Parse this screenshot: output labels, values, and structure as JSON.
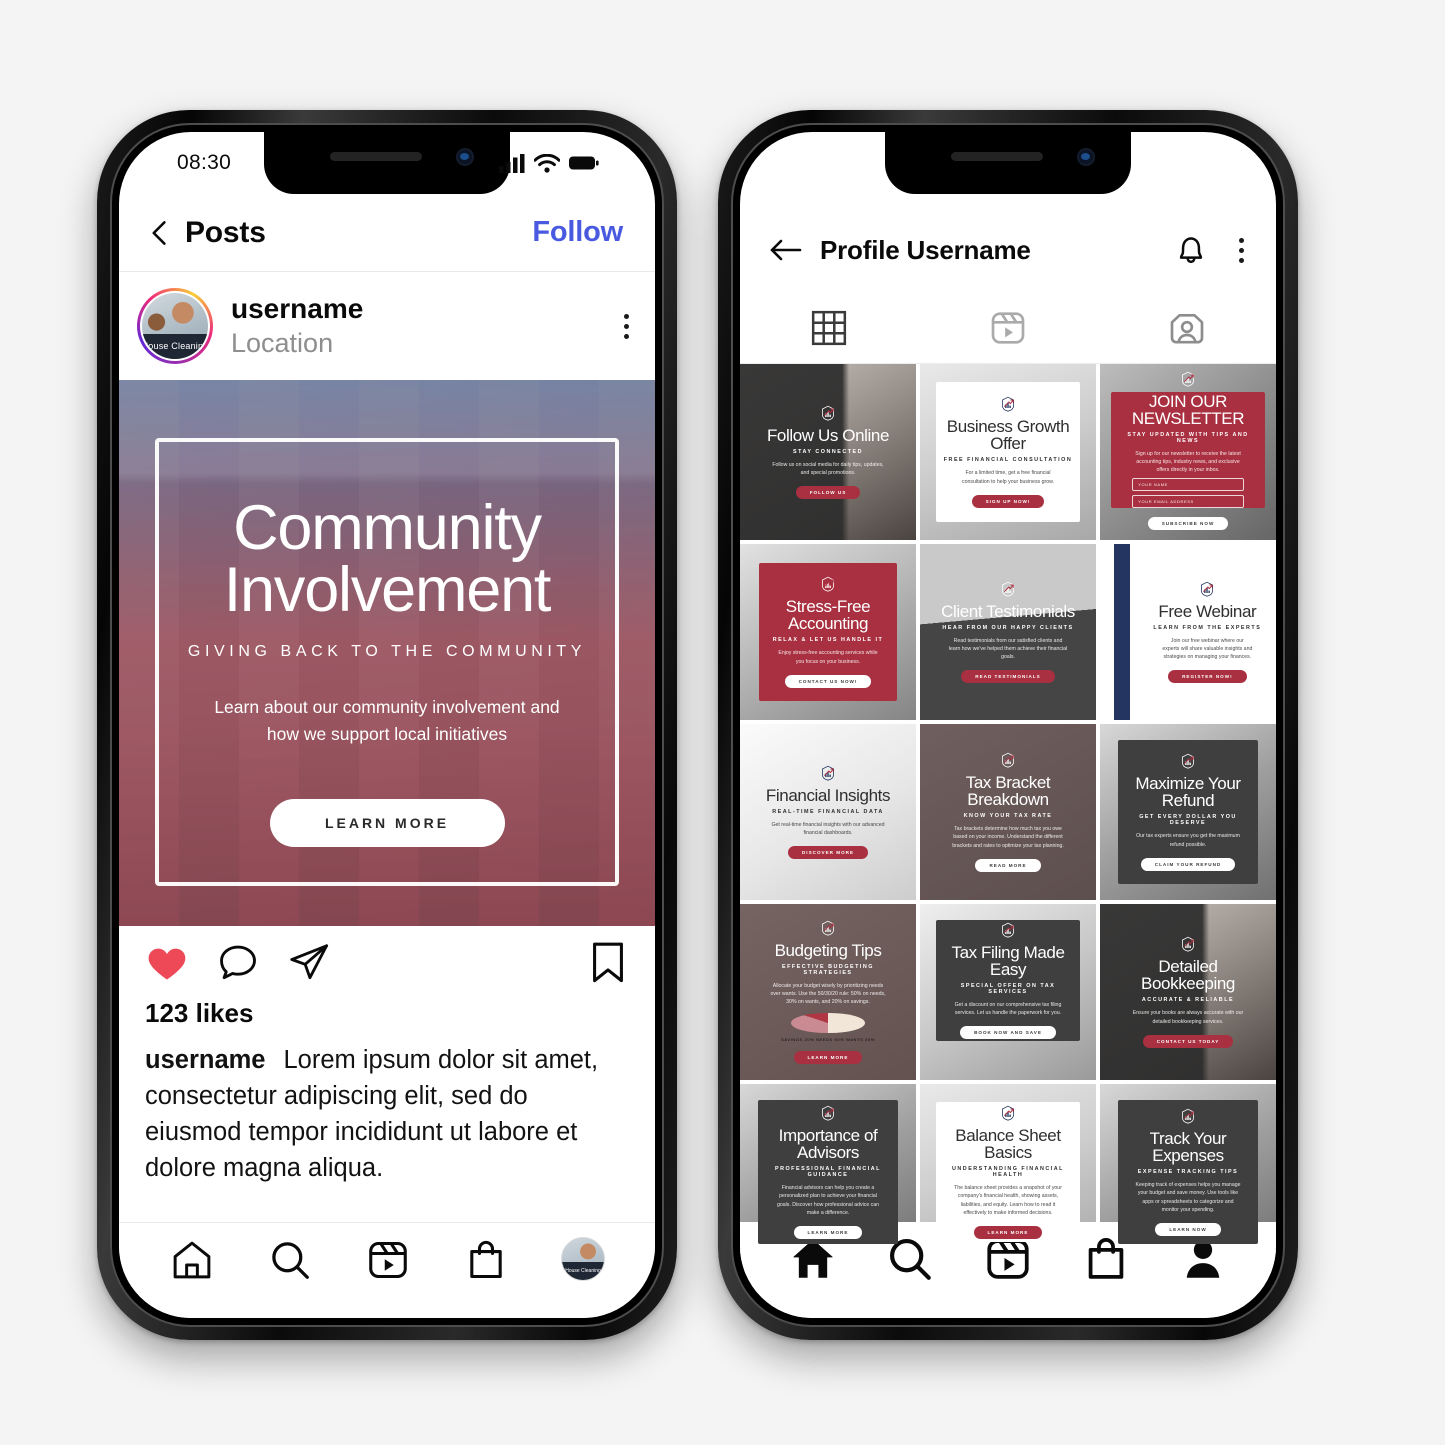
{
  "phone_one": {
    "status_bar": {
      "time": "08:30",
      "icons": [
        "signal-icon",
        "wifi-icon",
        "battery-icon"
      ]
    },
    "top_bar": {
      "back_icon": "chevron-left-icon",
      "title": "Posts",
      "follow_label": "Follow"
    },
    "post_header": {
      "avatar_caption": "House Cleaning",
      "username": "username",
      "location": "Location",
      "menu_icon": "kebab-menu-icon"
    },
    "post": {
      "title_line_1": "Community",
      "title_line_2": "Involvement",
      "subtitle": "GIVING BACK TO THE COMMUNITY",
      "description": "Learn about our community involvement and how we support local initiatives",
      "cta_label": "LEARN MORE",
      "gradient_top": "#23386c",
      "gradient_bottom": "#a8303f"
    },
    "actions": {
      "like_icon": "heart-icon-filled",
      "like_color": "#ed4956",
      "comment_icon": "comment-icon",
      "share_icon": "paper-plane-icon",
      "save_icon": "bookmark-icon"
    },
    "likes_text": "123 likes",
    "caption": {
      "username": "username",
      "text": "Lorem ipsum dolor sit amet, consectetur adipiscing elit, sed do eiusmod tempor incididunt ut labore et dolore magna aliqua."
    },
    "bottom_nav": [
      {
        "name": "home",
        "icon": "home-icon"
      },
      {
        "name": "search",
        "icon": "search-icon"
      },
      {
        "name": "reels",
        "icon": "reels-icon"
      },
      {
        "name": "shop",
        "icon": "shopping-bag-icon"
      },
      {
        "name": "profile",
        "icon": "avatar-icon",
        "avatar_caption": "House Cleaning"
      }
    ]
  },
  "phone_two": {
    "top_bar": {
      "back_icon": "arrow-left-icon",
      "title": "Profile Username",
      "bell_icon": "bell-icon",
      "menu_icon": "kebab-menu-icon"
    },
    "tabs": [
      {
        "id": "grid",
        "icon": "grid-icon",
        "active": true
      },
      {
        "id": "reels",
        "icon": "reels-icon",
        "active": false
      },
      {
        "id": "tagged",
        "icon": "tagged-person-icon",
        "active": false
      }
    ],
    "grid": [
      {
        "title": "Follow Us Online",
        "subtitle": "STAY CONNECTED",
        "body": "Follow us on social media for daily tips, updates, and special promotions.",
        "button": "FOLLOW US",
        "theme": "dark-photo-right"
      },
      {
        "title": "Business Growth Offer",
        "subtitle": "FREE FINANCIAL CONSULTATION",
        "body": "For a limited time, get a free financial consultation to help your business grow.",
        "button": "SIGN UP NOW!",
        "theme": "white-card"
      },
      {
        "title": "JOIN OUR NEWSLETTER",
        "subtitle": "STAY UPDATED WITH TIPS AND NEWS",
        "body": "Sign up for our newsletter to receive the latest accounting tips, industry news, and exclusive offers directly in your inbox.",
        "button": "SUBSCRIBE NOW",
        "fields": [
          "YOUR NAME",
          "YOUR EMAIL ADDRESS"
        ],
        "theme": "red-card"
      },
      {
        "title": "Stress-Free Accounting",
        "subtitle": "RELAX & LET US HANDLE IT",
        "body": "Enjoy stress-free accounting services while you focus on your business.",
        "button": "CONTACT US NOW!",
        "theme": "red-card-photo"
      },
      {
        "title": "Client Testimonials",
        "subtitle": "HEAR FROM OUR HAPPY CLIENTS",
        "body": "Read testimonials from our satisfied clients and learn how we've helped them achieve their financial goals.",
        "button": "READ TESTIMONIALS",
        "theme": "gray-photo"
      },
      {
        "title": "Free Webinar",
        "subtitle": "LEARN FROM THE EXPERTS",
        "body": "Join our free webinar where our experts will share valuable insights and strategies on managing your finances.",
        "button": "REGISTER NOW!",
        "theme": "white-split"
      },
      {
        "title": "Financial Insights",
        "subtitle": "REAL-TIME FINANCIAL DATA",
        "body": "Get real-time financial insights with our advanced financial dashboards.",
        "button": "DISCOVER MORE",
        "theme": "light-photo"
      },
      {
        "title": "Tax Bracket Breakdown",
        "subtitle": "KNOW YOUR TAX RATE",
        "body": "Tax brackets determine how much tax you owe based on your income. Understand the different brackets and rates to optimize your tax planning.",
        "button": "READ MORE",
        "theme": "mauve"
      },
      {
        "title": "Maximize Your Refund",
        "subtitle": "GET EVERY DOLLAR YOU DESERVE",
        "body": "Our tax experts ensure you get the maximum refund possible.",
        "button": "CLAIM YOUR REFUND",
        "theme": "charcoal-card"
      },
      {
        "title": "Budgeting Tips",
        "subtitle": "EFFECTIVE BUDGETING STRATEGIES",
        "body": "Allocate your budget wisely by prioritizing needs over wants. Use the 50/30/20 rule: 50% on needs, 30% on wants, and 20% on savings.",
        "button": "LEARN MORE",
        "theme": "mauve-pie",
        "pie_labels": [
          "SAVINGS 20%",
          "NEEDS 50%",
          "WANTS 30%"
        ]
      },
      {
        "title": "Tax Filing Made Easy",
        "subtitle": "SPECIAL OFFER ON TAX SERVICES",
        "body": "Get a discount on our comprehensive tax filing services. Let us handle the paperwork for you.",
        "button": "BOOK NOW AND SAVE",
        "theme": "charcoal-photo"
      },
      {
        "title": "Detailed Bookkeeping",
        "subtitle": "ACCURATE & RELIABLE",
        "body": "Ensure your books are always accurate with our detailed bookkeeping services.",
        "button": "CONTACT US TODAY",
        "theme": "dark-photo-right"
      },
      {
        "title": "Importance of Advisors",
        "subtitle": "PROFESSIONAL FINANCIAL GUIDANCE",
        "body": "Financial advisors can help you create a personalized plan to achieve your financial goals. Discover how professional advice can make a difference.",
        "button": "LEARN MORE",
        "theme": "charcoal-card"
      },
      {
        "title": "Balance Sheet Basics",
        "subtitle": "UNDERSTANDING FINANCIAL HEALTH",
        "body": "The balance sheet provides a snapshot of your company's financial health, showing assets, liabilities, and equity. Learn how to read it effectively to make informed decisions.",
        "button": "LEARN MORE",
        "theme": "white-card"
      },
      {
        "title": "Track Your Expenses",
        "subtitle": "EXPENSE TRACKING TIPS",
        "body": "Keeping track of expenses helps you manage your budget and save money. Use tools like apps or spreadsheets to categorize and monitor your spending.",
        "button": "LEARN NOW",
        "theme": "charcoal-card"
      }
    ],
    "bottom_nav": [
      {
        "name": "home",
        "icon": "home-icon-filled"
      },
      {
        "name": "search",
        "icon": "search-icon"
      },
      {
        "name": "reels",
        "icon": "reels-icon"
      },
      {
        "name": "shop",
        "icon": "shopping-bag-icon"
      },
      {
        "name": "profile",
        "icon": "person-icon-filled"
      }
    ]
  },
  "theme": {
    "brand_red": "#A93040",
    "brand_navy": "#233560",
    "like_red": "#ed4956",
    "follow_blue": "#4a5ae0",
    "page_bg": "#f4f4f4"
  }
}
